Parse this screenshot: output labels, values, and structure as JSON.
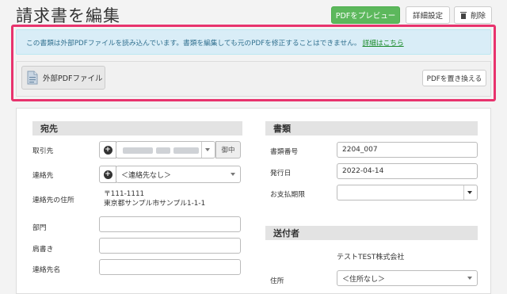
{
  "page": {
    "title": "請求書を編集",
    "buttons": {
      "preview": "PDFをプレビュー",
      "settings": "詳細設定",
      "delete": "削除"
    }
  },
  "notice": {
    "text": "この書類は外部PDFファイルを読み込んでいます。書類を編集しても元のPDFを修正することはできません。",
    "link": "詳細はこちら"
  },
  "external": {
    "file_label": "外部PDFファイル",
    "replace_button": "PDFを置き換える"
  },
  "recipient": {
    "heading": "宛先",
    "client_label": "取引先",
    "client_suffix": "御中",
    "contact_label": "連絡先",
    "contact_value": "＜連絡先なし＞",
    "address_label": "連絡先の住所",
    "address_line1": "〒111-1111",
    "address_line2": "東京都サンプル市サンプル1-1-1",
    "dept_label": "部門",
    "position_label": "肩書き",
    "contact_name_label": "連絡先名"
  },
  "document": {
    "heading": "書類",
    "number_label": "書類番号",
    "number_value": "2204_007",
    "issue_date_label": "発行日",
    "issue_date_value": "2022-04-14",
    "due_label": "お支払期限",
    "due_value": ""
  },
  "sender": {
    "heading": "送付者",
    "company": "テストTEST株式会社",
    "address_label": "住所",
    "address_value": "＜住所なし＞"
  },
  "colors": {
    "accent_green": "#5cb85c",
    "highlight": "#e8336d",
    "notice_bg": "#d9edf7"
  }
}
